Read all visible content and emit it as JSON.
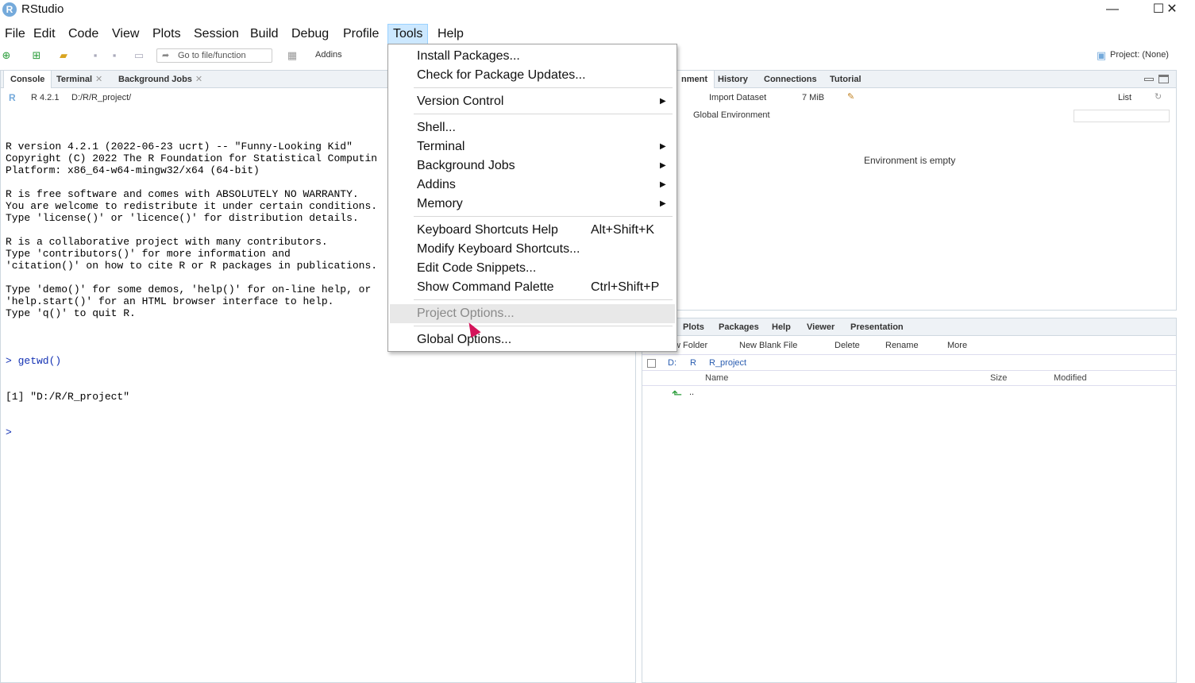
{
  "window": {
    "title": "RStudio",
    "minimize": "—",
    "maximize": "☐",
    "close": "✕"
  },
  "menubar": [
    "File",
    "Edit",
    "Code",
    "View",
    "Plots",
    "Session",
    "Build",
    "Debug",
    "Profile",
    "Tools",
    "Help"
  ],
  "toolbar": {
    "goto_placeholder": "Go to file/function",
    "addins": "Addins",
    "project": "Project: (None)"
  },
  "left_pane": {
    "tabs": [
      "Console",
      "Terminal",
      "Background Jobs"
    ],
    "rversion": "R 4.2.1",
    "path": "D:/R/R_project/",
    "console_lines": [
      "R version 4.2.1 (2022-06-23 ucrt) -- \"Funny-Looking Kid\"",
      "Copyright (C) 2022 The R Foundation for Statistical Computin",
      "Platform: x86_64-w64-mingw32/x64 (64-bit)",
      "",
      "R is free software and comes with ABSOLUTELY NO WARRANTY.",
      "You are welcome to redistribute it under certain conditions.",
      "Type 'license()' or 'licence()' for distribution details.",
      "",
      "R is a collaborative project with many contributors.",
      "Type 'contributors()' for more information and",
      "'citation()' on how to cite R or R packages in publications.",
      "",
      "Type 'demo()' for some demos, 'help()' for on-line help, or",
      "'help.start()' for an HTML browser interface to help.",
      "Type 'q()' to quit R.",
      ""
    ],
    "cmd1": "> getwd()",
    "out1": "[1] \"D:/R/R_project\"",
    "prompt": ">"
  },
  "env_pane": {
    "tabs": [
      "nment",
      "History",
      "Connections",
      "Tutorial"
    ],
    "import_dataset": "Import Dataset",
    "memory": "7 MiB",
    "list_view": "List",
    "scope": "Global Environment",
    "empty_msg": "Environment is empty"
  },
  "files_pane": {
    "tabs": [
      "Plots",
      "Packages",
      "Help",
      "Viewer",
      "Presentation"
    ],
    "new_folder": "w Folder",
    "new_blank_file": "New Blank File",
    "delete": "Delete",
    "rename": "Rename",
    "more": "More",
    "breadcrumb": [
      "D:",
      "R",
      "R_project"
    ],
    "columns": [
      "Name",
      "Size",
      "Modified"
    ],
    "parent_row": ".."
  },
  "tools_menu": {
    "items": [
      {
        "label": "Install Packages...",
        "shortcut": "",
        "submenu": false,
        "disabled": false
      },
      {
        "label": "Check for Package Updates...",
        "shortcut": "",
        "submenu": false,
        "disabled": false
      },
      {
        "label": "Version Control",
        "shortcut": "",
        "submenu": true,
        "disabled": false
      },
      {
        "label": "Shell...",
        "shortcut": "",
        "submenu": false,
        "disabled": false
      },
      {
        "label": "Terminal",
        "shortcut": "",
        "submenu": true,
        "disabled": false
      },
      {
        "label": "Background Jobs",
        "shortcut": "",
        "submenu": true,
        "disabled": false
      },
      {
        "label": "Addins",
        "shortcut": "",
        "submenu": true,
        "disabled": false
      },
      {
        "label": "Memory",
        "shortcut": "",
        "submenu": true,
        "disabled": false
      },
      {
        "label": "Keyboard Shortcuts Help",
        "shortcut": "Alt+Shift+K",
        "submenu": false,
        "disabled": false
      },
      {
        "label": "Modify Keyboard Shortcuts...",
        "shortcut": "",
        "submenu": false,
        "disabled": false
      },
      {
        "label": "Edit Code Snippets...",
        "shortcut": "",
        "submenu": false,
        "disabled": false
      },
      {
        "label": "Show Command Palette",
        "shortcut": "Ctrl+Shift+P",
        "submenu": false,
        "disabled": false
      },
      {
        "label": "Project Options...",
        "shortcut": "",
        "submenu": false,
        "disabled": true
      },
      {
        "label": "Global Options...",
        "shortcut": "",
        "submenu": false,
        "disabled": false
      }
    ]
  }
}
